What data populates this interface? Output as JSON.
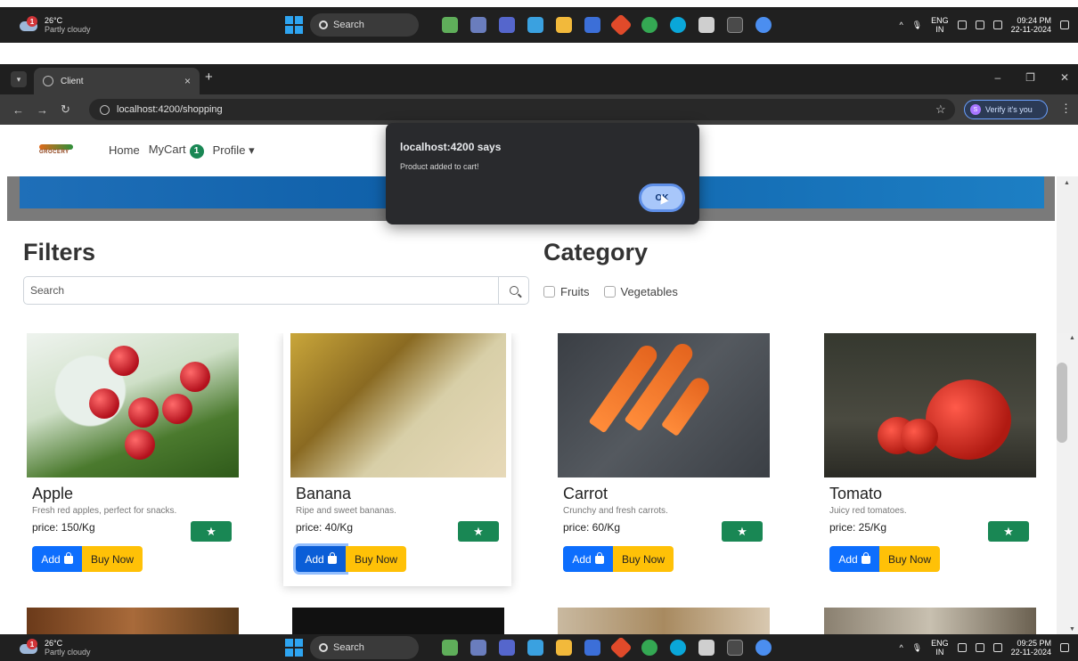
{
  "taskbar_top": {
    "temp": "26°C",
    "weather": "Partly cloudy",
    "notif_count": "1",
    "search": "Search",
    "lang1": "ENG",
    "lang2": "IN",
    "time": "09:24 PM",
    "date": "22-11-2024"
  },
  "taskbar_bottom": {
    "temp": "26°C",
    "weather": "Partly cloudy",
    "notif_count": "1",
    "search": "Search",
    "lang1": "ENG",
    "lang2": "IN",
    "time": "09:25 PM",
    "date": "22-11-2024"
  },
  "browser": {
    "tab_title": "Client",
    "url": "localhost:4200/shopping",
    "verify_label": "Verify it's you"
  },
  "nav": {
    "logo_text": "GROCERY",
    "home": "Home",
    "mycart": "MyCart",
    "cart_count": "1",
    "profile": "Profile"
  },
  "filters": {
    "title": "Filters",
    "search_placeholder": "Search",
    "category_title": "Category",
    "categories": [
      "Fruits",
      "Vegetables"
    ]
  },
  "products": [
    {
      "name": "Apple",
      "desc": "Fresh red apples, perfect for snacks.",
      "price": "price: 150/Kg"
    },
    {
      "name": "Banana",
      "desc": "Ripe and sweet bananas.",
      "price": "price: 40/Kg"
    },
    {
      "name": "Carrot",
      "desc": "Crunchy and fresh carrots.",
      "price": "price: 60/Kg"
    },
    {
      "name": "Tomato",
      "desc": "Juicy red tomatoes.",
      "price": "price: 25/Kg"
    }
  ],
  "buttons": {
    "add": "Add",
    "buy": "Buy Now"
  },
  "dialog": {
    "title": "localhost:4200 says",
    "message": "Product added to cart!",
    "ok": "OK"
  },
  "colors": {
    "primary": "#0d6efd",
    "warning": "#ffc107",
    "success": "#198754"
  }
}
